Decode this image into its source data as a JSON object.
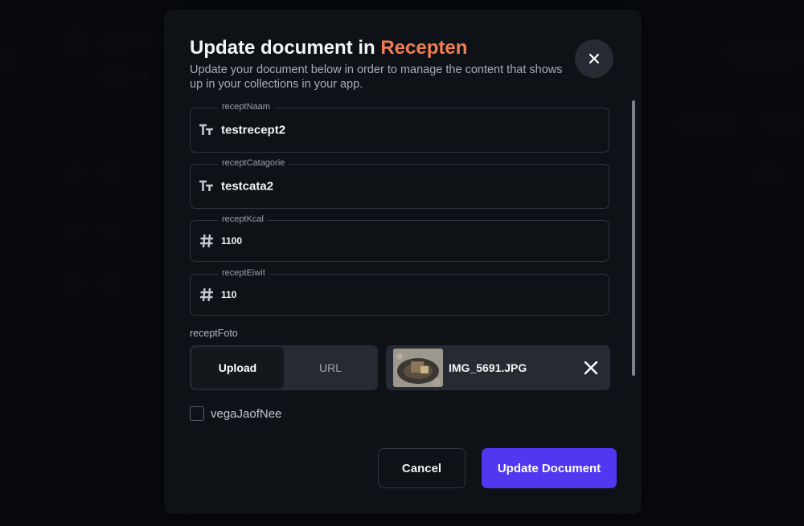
{
  "modal": {
    "title_prefix": "Update document in",
    "title_collection": "Recepten",
    "subtitle": "Update your document below in order to manage the content that shows up in your collections in your app."
  },
  "fields": [
    {
      "label": "receptNaam",
      "value": "testrecept2",
      "icon": "text-type-icon"
    },
    {
      "label": "receptCatagorie",
      "value": "testcata2",
      "icon": "text-type-icon"
    },
    {
      "label": "receptKcal",
      "value": "1100",
      "icon": "hash-icon"
    },
    {
      "label": "receptEiwit",
      "value": "110",
      "icon": "hash-icon"
    }
  ],
  "file_field": {
    "label": "receptFoto",
    "tabs": [
      "Upload",
      "URL"
    ],
    "active_tab": "Upload",
    "filename": "IMG_5691.JPG"
  },
  "checkbox": {
    "label": "vegaJaofNee",
    "checked": false
  },
  "buttons": {
    "cancel": "Cancel",
    "update": "Update Document"
  },
  "colors": {
    "accent": "#f07e55",
    "primary": "#5137f0"
  }
}
